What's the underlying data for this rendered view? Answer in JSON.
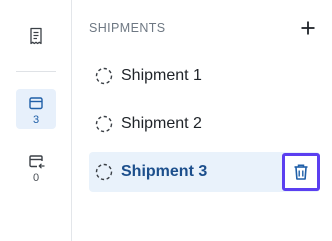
{
  "rail": {
    "top_icon": "receipt-icon",
    "items": [
      {
        "icon": "package-icon",
        "count": "3",
        "active": true
      },
      {
        "icon": "package-return-icon",
        "count": "0",
        "active": false
      }
    ]
  },
  "header": {
    "title": "SHIPMENTS",
    "add_icon": "plus-icon"
  },
  "shipments": [
    {
      "label": "Shipment 1",
      "status_icon": "dashed-circle-icon",
      "selected": false
    },
    {
      "label": "Shipment 2",
      "status_icon": "dashed-circle-icon",
      "selected": false
    },
    {
      "label": "Shipment 3",
      "status_icon": "dashed-circle-icon",
      "selected": true,
      "action_icon": "trash-icon"
    }
  ],
  "colors": {
    "accent": "#1f5fa8",
    "selected_bg": "#e9f2fb",
    "focus_outline": "#5b3ff0"
  }
}
